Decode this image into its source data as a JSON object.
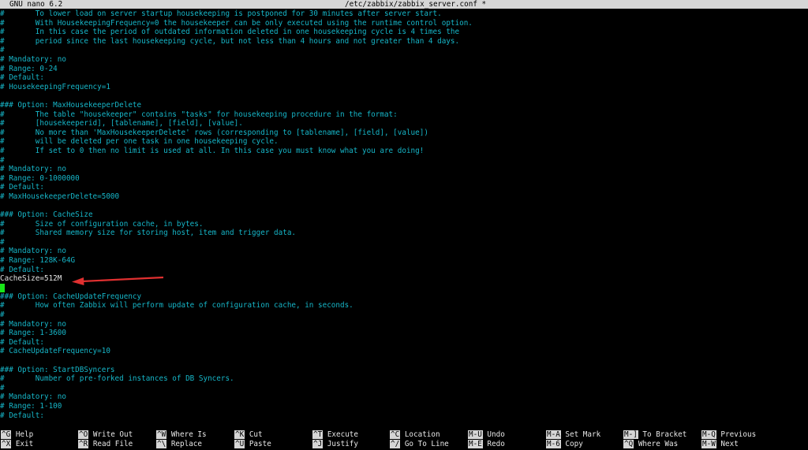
{
  "titlebar": {
    "app": "GNU nano 6.2",
    "file": "/etc/zabbix/zabbix_server.conf *"
  },
  "editor": {
    "lines": [
      {
        "text": "#       To lower load on server startup housekeeping is postponed for 30 minutes after server start.",
        "kind": "comment"
      },
      {
        "text": "#       With HousekeepingFrequency=0 the housekeeper can be only executed using the runtime control option.",
        "kind": "comment"
      },
      {
        "text": "#       In this case the period of outdated information deleted in one housekeeping cycle is 4 times the",
        "kind": "comment"
      },
      {
        "text": "#       period since the last housekeeping cycle, but not less than 4 hours and not greater than 4 days.",
        "kind": "comment"
      },
      {
        "text": "#",
        "kind": "comment"
      },
      {
        "text": "# Mandatory: no",
        "kind": "comment"
      },
      {
        "text": "# Range: 0-24",
        "kind": "comment"
      },
      {
        "text": "# Default:",
        "kind": "comment"
      },
      {
        "text": "# HousekeepingFrequency=1",
        "kind": "comment"
      },
      {
        "text": "",
        "kind": "blank"
      },
      {
        "text": "### Option: MaxHousekeeperDelete",
        "kind": "comment"
      },
      {
        "text": "#       The table \"housekeeper\" contains \"tasks\" for housekeeping procedure in the format:",
        "kind": "comment"
      },
      {
        "text": "#       [housekeeperid], [tablename], [field], [value].",
        "kind": "comment"
      },
      {
        "text": "#       No more than 'MaxHousekeeperDelete' rows (corresponding to [tablename], [field], [value])",
        "kind": "comment"
      },
      {
        "text": "#       will be deleted per one task in one housekeeping cycle.",
        "kind": "comment"
      },
      {
        "text": "#       If set to 0 then no limit is used at all. In this case you must know what you are doing!",
        "kind": "comment"
      },
      {
        "text": "#",
        "kind": "comment"
      },
      {
        "text": "# Mandatory: no",
        "kind": "comment"
      },
      {
        "text": "# Range: 0-1000000",
        "kind": "comment"
      },
      {
        "text": "# Default:",
        "kind": "comment"
      },
      {
        "text": "# MaxHousekeeperDelete=5000",
        "kind": "comment"
      },
      {
        "text": "",
        "kind": "blank"
      },
      {
        "text": "### Option: CacheSize",
        "kind": "comment"
      },
      {
        "text": "#       Size of configuration cache, in bytes.",
        "kind": "comment"
      },
      {
        "text": "#       Shared memory size for storing host, item and trigger data.",
        "kind": "comment"
      },
      {
        "text": "#",
        "kind": "comment"
      },
      {
        "text": "# Mandatory: no",
        "kind": "comment"
      },
      {
        "text": "# Range: 128K-64G",
        "kind": "comment"
      },
      {
        "text": "# Default:",
        "kind": "comment"
      },
      {
        "text": "CacheSize=512M",
        "kind": "code"
      },
      {
        "text": "",
        "kind": "cursor"
      },
      {
        "text": "### Option: CacheUpdateFrequency",
        "kind": "comment"
      },
      {
        "text": "#       How often Zabbix will perform update of configuration cache, in seconds.",
        "kind": "comment"
      },
      {
        "text": "#",
        "kind": "comment"
      },
      {
        "text": "# Mandatory: no",
        "kind": "comment"
      },
      {
        "text": "# Range: 1-3600",
        "kind": "comment"
      },
      {
        "text": "# Default:",
        "kind": "comment"
      },
      {
        "text": "# CacheUpdateFrequency=10",
        "kind": "comment"
      },
      {
        "text": "",
        "kind": "blank"
      },
      {
        "text": "### Option: StartDBSyncers",
        "kind": "comment"
      },
      {
        "text": "#       Number of pre-forked instances of DB Syncers.",
        "kind": "comment"
      },
      {
        "text": "#",
        "kind": "comment"
      },
      {
        "text": "# Mandatory: no",
        "kind": "comment"
      },
      {
        "text": "# Range: 1-100",
        "kind": "comment"
      },
      {
        "text": "# Default:",
        "kind": "comment"
      }
    ]
  },
  "colors": {
    "comment": "#16b6c8",
    "code": "#e6e6e6",
    "cursor": "#19e619",
    "arrow": "#e03030",
    "key_bg": "#d6d6d6"
  },
  "help": {
    "row1": [
      {
        "key": "^G",
        "label": "Help"
      },
      {
        "key": "^O",
        "label": "Write Out"
      },
      {
        "key": "^W",
        "label": "Where Is"
      },
      {
        "key": "^K",
        "label": "Cut"
      },
      {
        "key": "^T",
        "label": "Execute"
      },
      {
        "key": "^C",
        "label": "Location"
      },
      {
        "key": "M-U",
        "label": "Undo"
      },
      {
        "key": "M-A",
        "label": "Set Mark"
      },
      {
        "key": "M-]",
        "label": "To Bracket"
      },
      {
        "key": "M-Q",
        "label": "Previous"
      }
    ],
    "row2": [
      {
        "key": "^X",
        "label": "Exit"
      },
      {
        "key": "^R",
        "label": "Read File"
      },
      {
        "key": "^\\",
        "label": "Replace"
      },
      {
        "key": "^U",
        "label": "Paste"
      },
      {
        "key": "^J",
        "label": "Justify"
      },
      {
        "key": "^/",
        "label": "Go To Line"
      },
      {
        "key": "M-E",
        "label": "Redo"
      },
      {
        "key": "M-6",
        "label": "Copy"
      },
      {
        "key": "^Q",
        "label": "Where Was"
      },
      {
        "key": "M-W",
        "label": "Next"
      }
    ]
  }
}
